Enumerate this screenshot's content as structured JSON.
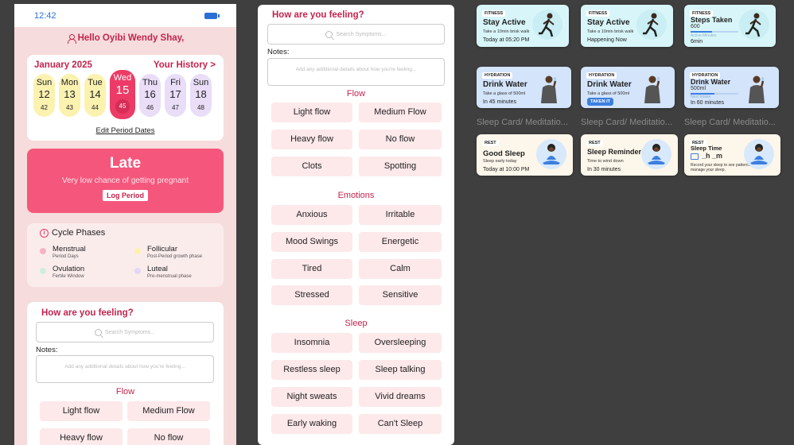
{
  "status": {
    "time": "12:42"
  },
  "greeting": "Hello Oyibi Wendy Shay,",
  "calendar": {
    "month": "January 2025",
    "history_link": "Your History >",
    "edit_link": "Edit Period Dates",
    "days": [
      {
        "dow": "Sun",
        "num": "12",
        "cyc": "42"
      },
      {
        "dow": "Mon",
        "num": "13",
        "cyc": "43"
      },
      {
        "dow": "Tue",
        "num": "14",
        "cyc": "44"
      },
      {
        "dow": "Wed",
        "num": "15",
        "cyc": "45"
      },
      {
        "dow": "Thu",
        "num": "16",
        "cyc": "46"
      },
      {
        "dow": "Fri",
        "num": "17",
        "cyc": "47"
      },
      {
        "dow": "Sun",
        "num": "18",
        "cyc": "48"
      }
    ]
  },
  "status_card": {
    "title": "Late",
    "subtitle": "Very low chance of getting pregnant",
    "button": "Log Period"
  },
  "phases": {
    "title": "Cycle Phases",
    "items": [
      {
        "name": "Menstrual",
        "desc": "Period Days",
        "color": "#f7b3c2"
      },
      {
        "name": "Follicular",
        "desc": "Post-Period growth phase",
        "color": "#fbf2b0"
      },
      {
        "name": "Ovulation",
        "desc": "Fertile Window",
        "color": "#cfeedd"
      },
      {
        "name": "Luteal",
        "desc": "Pre-menstrual phase",
        "color": "#e3d6f7"
      }
    ]
  },
  "feeling": {
    "title": "How are you feeling?",
    "search_placeholder": "Search Symptoms...",
    "notes_label": "Notes:",
    "notes_placeholder": "Add any additional details about how you're feeling...",
    "flow_title": "Flow",
    "flow": [
      "Light flow",
      "Medium Flow",
      "Heavy flow",
      "No flow",
      "Clots",
      "Spotting"
    ],
    "emotions_title": "Emotions",
    "emotions": [
      "Anxious",
      "Irritable",
      "Mood Swings",
      "Energetic",
      "Tired",
      "Calm",
      "Stressed",
      "Sensitive"
    ],
    "sleep_title": "Sleep",
    "sleep": [
      "Insomnia",
      "Oversleeping",
      "Restless sleep",
      "Sleep talking",
      "Night sweats",
      "Vivid dreams",
      "Early waking",
      "Can't Sleep"
    ]
  },
  "cards": {
    "fitness": [
      {
        "tag": "FITNESS",
        "title": "Stay Active",
        "sub": "Take a 10min brisk walk",
        "bottom": "Today at 05:20 PM"
      },
      {
        "tag": "FITNESS",
        "title": "Stay Active",
        "sub": "Take a 10min brisk walk",
        "bottom": "Happening Now"
      },
      {
        "tag": "FITNESS",
        "title": "Steps Taken",
        "sub": "600",
        "sub2": "Active Minutes",
        "bottom": "6min",
        "progress": 0.45
      }
    ],
    "hydration": [
      {
        "tag": "HYDRATION",
        "title": "Drink Water",
        "sub": "Take a glass of 500ml",
        "bottom": "In 45 minutes"
      },
      {
        "tag": "HYDRATION",
        "title": "Drink Water",
        "sub": "Take a glass of 500ml",
        "button": "TAKEN IT"
      },
      {
        "tag": "HYDRATION",
        "title": "Drink Water",
        "sub": "500ml",
        "sub2": "Next Intake",
        "bottom": "In 60 minutes",
        "progress": 0.5
      }
    ],
    "sleep_labels": [
      "Sleep Card/ Meditatio...",
      "Sleep Card/ Meditatio...",
      "Sleep Card/ Meditatio..."
    ],
    "sleep": [
      {
        "tag": "REST",
        "title": "Good Sleep",
        "sub": "Sleep early today",
        "bottom": "Today at 10:00 PM"
      },
      {
        "tag": "REST",
        "title": "Sleep Reminder",
        "sub": "Time to wind down",
        "bottom": "In 30 minutes"
      },
      {
        "tag": "REST",
        "title": "Sleep Time",
        "sub": "_h _m",
        "desc": "Record your sleep to see patterns and manage your sleep."
      }
    ]
  }
}
